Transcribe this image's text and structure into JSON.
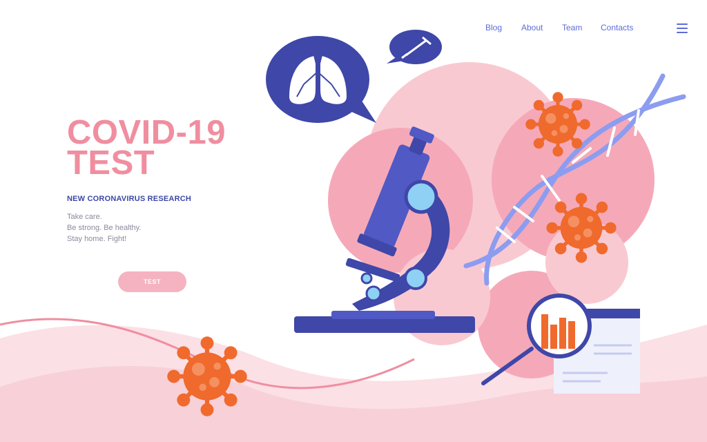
{
  "nav": {
    "items": [
      {
        "label": "Blog"
      },
      {
        "label": "About"
      },
      {
        "label": "Team"
      },
      {
        "label": "Contacts"
      }
    ]
  },
  "hero": {
    "title_line1": "COVID-19",
    "title_line2": "TEST",
    "subtitle": "NEW CORONAVIRUS RESEARCH",
    "body_lines": [
      "Take care.",
      "Be strong. Be healthy.",
      "Stay home. Fight!"
    ],
    "cta_label": "TEST"
  },
  "colors": {
    "accent_pink": "#f08ea0",
    "blob_pink": "#f7c5ce",
    "navy": "#3f47a8",
    "virus_orange": "#f06a2e",
    "dna_blue": "#8c9cf0"
  },
  "icons": [
    "hamburger-menu-icon",
    "lungs-icon",
    "syringe-icon",
    "microscope-icon",
    "dna-icon",
    "virus-icon",
    "magnifier-icon",
    "document-icon"
  ]
}
